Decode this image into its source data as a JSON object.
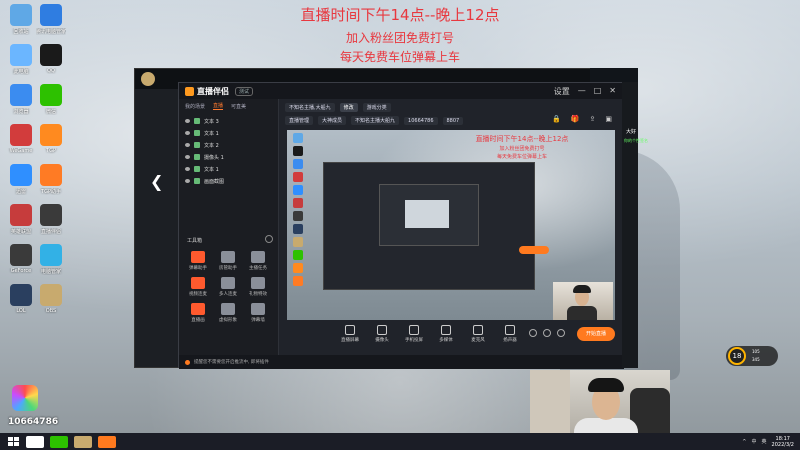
{
  "overlay": {
    "line1": "直播时间下午14点--晚上12点",
    "line2": "加入粉丝团免费打号",
    "line3": "每天免费车位弹幕上车",
    "fan_id": "10664786"
  },
  "desktop_icons": [
    {
      "label": "回收站",
      "color": "#5fa8e6"
    },
    {
      "label": "腾讯电脑管家",
      "color": "#2f7de1"
    },
    {
      "label": "此电脑",
      "color": "#6bb6ff"
    },
    {
      "label": "QQ",
      "color": "#1a1a1a"
    },
    {
      "label": "浏览器",
      "color": "#3b8cf0"
    },
    {
      "label": "微信",
      "color": "#2dc100"
    },
    {
      "label": "WeGame",
      "color": "#d23c3c"
    },
    {
      "label": "TGP",
      "color": "#ff8a1f"
    },
    {
      "label": "迅雷",
      "color": "#2f8fff"
    },
    {
      "label": "TGP助手",
      "color": "#ff7b24"
    },
    {
      "label": "英雄联盟",
      "color": "#c63c3c"
    },
    {
      "label": "直播伴侣",
      "color": "#3a3a3a"
    },
    {
      "label": "GeForce",
      "color": "#3a3a3a"
    },
    {
      "label": "电脑管家",
      "color": "#32b1e6"
    },
    {
      "label": "LOL",
      "color": "#2a3f5f"
    },
    {
      "label": "OBS",
      "color": "#c8aa6e"
    }
  ],
  "app": {
    "title": "直播伴侣",
    "version": "测试",
    "window_controls": [
      "设置",
      "—",
      "□",
      "✕"
    ],
    "tabs": [
      "我的场景",
      "直播",
      "可直美"
    ],
    "sources": [
      {
        "label": "文本 3"
      },
      {
        "label": "文本 1"
      },
      {
        "label": "文本 2"
      },
      {
        "label": "摄像头 1"
      },
      {
        "label": "文本 1"
      },
      {
        "label": "画面截图"
      }
    ],
    "tools_title": "工具箱",
    "tools": [
      {
        "label": "弹幕助手",
        "color": "#ff5a2e"
      },
      {
        "label": "房管助手",
        "color": "#8a8f99"
      },
      {
        "label": "主播任务",
        "color": "#8a8f99"
      },
      {
        "label": "视频连麦",
        "color": "#ff5a2e"
      },
      {
        "label": "多人连麦",
        "color": "#8a8f99"
      },
      {
        "label": "礼物特效",
        "color": "#8a8f99"
      },
      {
        "label": "直播画",
        "color": "#ff5a2e"
      },
      {
        "label": "虚拟形象",
        "color": "#8a8f99"
      },
      {
        "label": "弹幕墙",
        "color": "#8a8f99"
      }
    ],
    "stage": {
      "title_placeholder": "不知名主播,大船九",
      "edit_label": "修改",
      "category": "游戏分类",
      "live_room": "直播管理",
      "room_id": "10664786",
      "room_label": "大神成员",
      "viewers": "8807",
      "room_note": "不知名主播大船九"
    },
    "canvas_banner": {
      "c1": "直播时间下午14点--晚上12点",
      "c2": "加入粉丝团免费打号",
      "c3": "每天免费车位弹幕上车"
    },
    "bottom_tools": [
      {
        "label": "直播屏幕"
      },
      {
        "label": "摄像头"
      },
      {
        "label": "手机投屏"
      },
      {
        "label": "多媒体"
      },
      {
        "label": "麦克风"
      },
      {
        "label": "扬声器"
      }
    ],
    "start_live": "开始直播",
    "status_text": "提醒您不需要您开启推流中, 即将插件"
  },
  "side": {
    "text": "大好",
    "text2": "你的个性签名"
  },
  "live_badge": {
    "number": "18",
    "l1": "105",
    "l2": "345"
  },
  "taskbar": {
    "items": [
      {
        "color": "#ffffff"
      },
      {
        "color": "#2dc100"
      },
      {
        "color": "#c8aa6e"
      },
      {
        "color": "#ff7a1f"
      }
    ],
    "tray": [
      "^",
      "中",
      "英"
    ],
    "time": "18:17",
    "date": "2022/3/2"
  }
}
